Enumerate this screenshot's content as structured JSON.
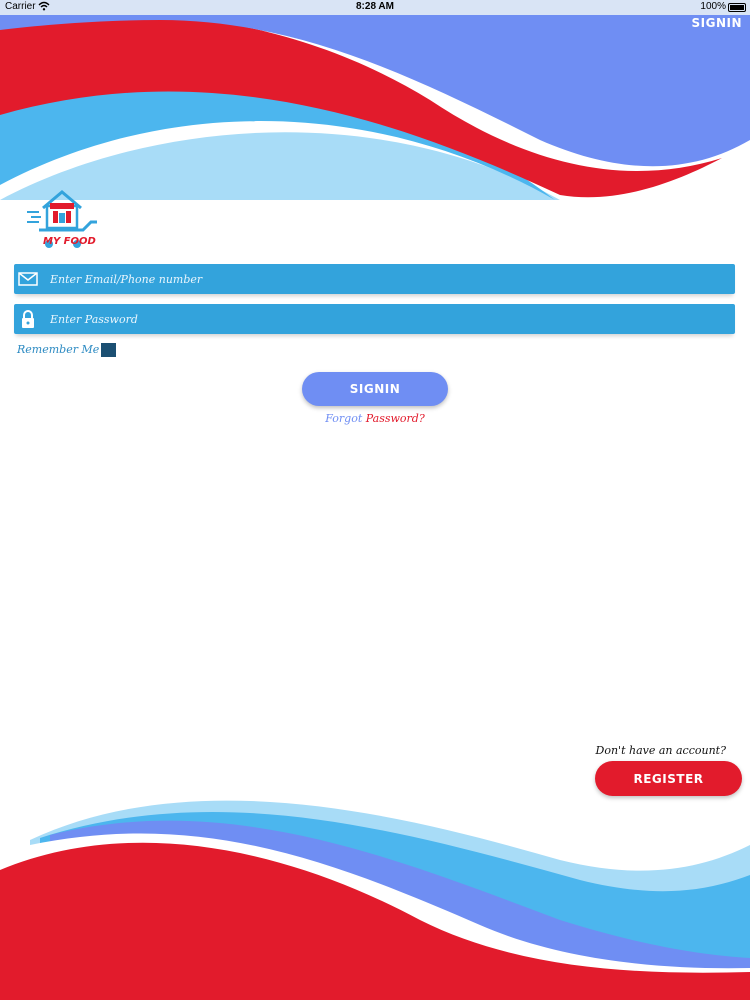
{
  "status_bar": {
    "carrier": "Carrier",
    "time": "8:28 AM",
    "battery": "100%"
  },
  "header": {
    "signin_label": "SIGNIN"
  },
  "logo": {
    "text": "MY FOOD"
  },
  "form": {
    "email_placeholder": "Enter Email/Phone number",
    "email_icon": "mail-icon",
    "password_placeholder": "Enter Password",
    "password_icon": "lock-icon",
    "remember_label": "Remember Me",
    "remember_checked": false,
    "signin_label": "SIGNIN",
    "forgot_part1": "Forgot",
    "forgot_part2": "Password?"
  },
  "footer": {
    "no_account_text": "Don't have an account?",
    "register_label": "REGISTER"
  },
  "colors": {
    "blue": "#6f8ef3",
    "light_blue": "#4cb6ee",
    "red": "#e21b2c",
    "field_blue": "#33a3dc"
  }
}
